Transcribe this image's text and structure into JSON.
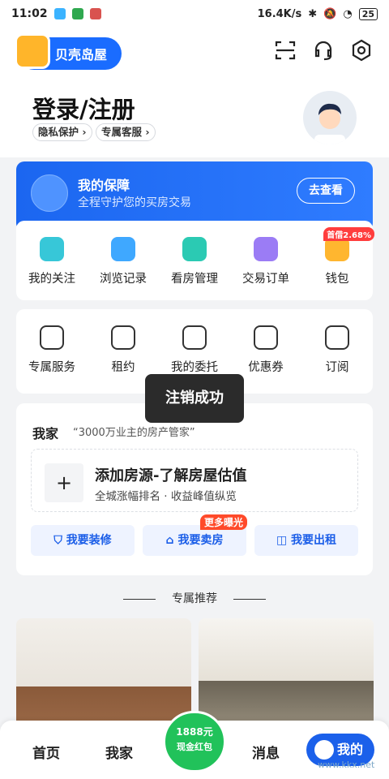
{
  "status_bar": {
    "time": "11:02",
    "speed": "16.4K/s",
    "battery": "25"
  },
  "header": {
    "logo_text": "贝壳岛屋",
    "title": "登录/注册",
    "chips": [
      "隐私保护 ›",
      "专属客服 ›"
    ],
    "icons": [
      "scan-icon",
      "headset-icon",
      "settings-icon"
    ]
  },
  "guarantee": {
    "title": "我的保障",
    "subtitle": "全程守护您的买房交易",
    "button": "去查看"
  },
  "quick_row1": [
    {
      "label": "我的关注",
      "icon": "heart-icon"
    },
    {
      "label": "浏览记录",
      "icon": "chat-icon"
    },
    {
      "label": "看房管理",
      "icon": "camera-icon"
    },
    {
      "label": "交易订单",
      "icon": "clipboard-icon"
    },
    {
      "label": "钱包",
      "icon": "wallet-icon",
      "badge": "首借2.68%"
    }
  ],
  "quick_row2": [
    {
      "label": "专属服务",
      "icon": "grid-icon"
    },
    {
      "label": "租约",
      "icon": "calendar-icon"
    },
    {
      "label": "我的委托",
      "icon": "person-doc-icon"
    },
    {
      "label": "优惠券",
      "icon": "ticket-icon"
    },
    {
      "label": "订阅",
      "icon": "bookmark-icon"
    }
  ],
  "toast": "注销成功",
  "my_home": {
    "title": "我家",
    "slogan": "“3000万业主的房产管家”",
    "add_title": "添加房源-了解房屋估值",
    "add_subtitle": "全城涨幅排名 · 收益峰值纵览",
    "actions": [
      "我要装修",
      "我要卖房",
      "我要出租"
    ],
    "sell_badge": "更多曝光"
  },
  "recommend_title": "专属推荐",
  "tabbar": {
    "items": [
      "首页",
      "我家",
      "消息"
    ],
    "redbag_value": "1888元",
    "redbag_sub": "现金红包",
    "mine": "我的"
  },
  "watermark": "www.kkx.net"
}
